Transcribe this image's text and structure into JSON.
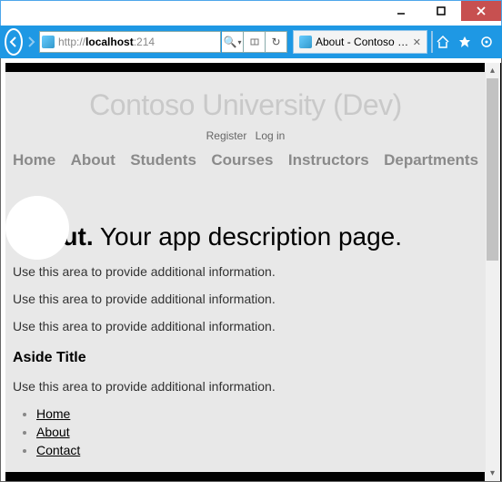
{
  "browser": {
    "url_protocol": "http://",
    "url_host": "localhost",
    "url_rest": ":214",
    "tab_title": "About - Contoso Univ...",
    "search_glyph": "🔍",
    "refresh_glyph": "↻",
    "dropdown_glyph": "▾",
    "stop_glyph": "→"
  },
  "header": {
    "site_title": "Contoso University (Dev)",
    "register": "Register",
    "login": "Log in"
  },
  "nav": {
    "items": [
      "Home",
      "About",
      "Students",
      "Courses",
      "Instructors",
      "Departments"
    ]
  },
  "content": {
    "heading_strong": "About.",
    "heading_rest": " Your app description page.",
    "para1": "Use this area to provide additional information.",
    "para2": "Use this area to provide additional information.",
    "para3": "Use this area to provide additional information.",
    "aside_title": "Aside Title",
    "aside_para": "Use this area to provide additional information.",
    "links": [
      "Home",
      "About",
      "Contact"
    ]
  }
}
